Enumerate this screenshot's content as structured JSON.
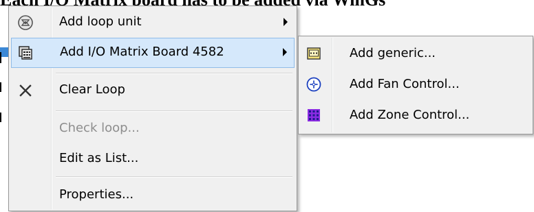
{
  "background": {
    "heading_text": "Each I/O Matrix board has to be added via WinGs"
  },
  "context_menu": {
    "items": [
      {
        "label": "Add loop unit",
        "icon": "loop-unit-icon",
        "has_submenu": true,
        "enabled": true
      },
      {
        "label": "Add I/O Matrix Board 4582",
        "icon": "io-matrix-board-icon",
        "has_submenu": true,
        "enabled": true,
        "highlighted": true
      },
      {
        "label": "Clear Loop",
        "icon": "clear-x-icon",
        "has_submenu": false,
        "enabled": true
      },
      {
        "label": "Check loop...",
        "icon": "",
        "has_submenu": false,
        "enabled": false
      },
      {
        "label": "Edit as List...",
        "icon": "",
        "has_submenu": false,
        "enabled": true
      },
      {
        "label": "Properties...",
        "icon": "",
        "has_submenu": false,
        "enabled": true
      }
    ]
  },
  "submenu": {
    "items": [
      {
        "label": "Add generic...",
        "icon": "generic-board-icon"
      },
      {
        "label": "Add Fan Control...",
        "icon": "fan-icon"
      },
      {
        "label": "Add Zone Control...",
        "icon": "zone-grid-icon"
      }
    ]
  },
  "colors": {
    "menu_background": "#f0f0f0",
    "highlight_background": "#d5e8fb",
    "highlight_border": "#8fbbe8",
    "disabled_text": "#8d8d8d",
    "fan_icon_blue": "#1a3fbf",
    "zone_icon_purple": "#8a2be2"
  }
}
